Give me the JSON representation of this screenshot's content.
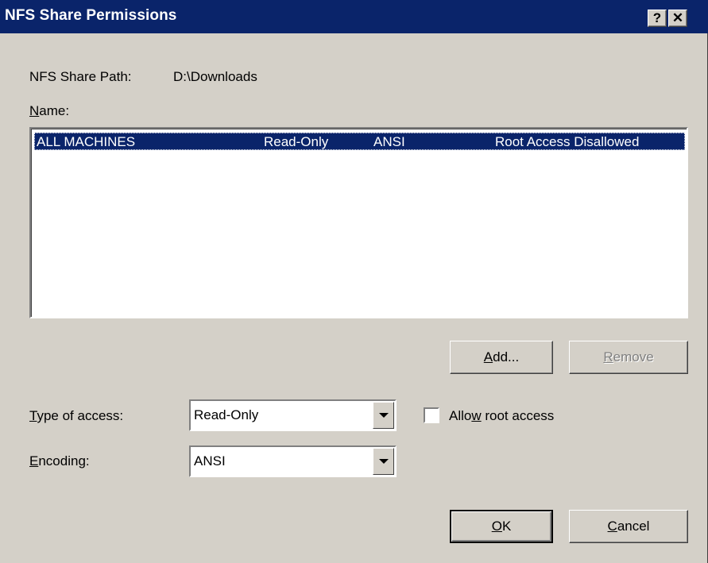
{
  "window": {
    "title": "NFS Share Permissions",
    "help_button": "?",
    "close_button": "✕"
  },
  "share": {
    "path_label": "NFS Share Path:",
    "path_value": "D:\\Downloads"
  },
  "name_label": {
    "mnemonic": "N",
    "rest": "ame:"
  },
  "permissions_list": {
    "rows": [
      {
        "name": "ALL MACHINES",
        "access": "Read-Only",
        "encoding": "ANSI",
        "root_access": "Root Access Disallowed",
        "selected": true
      }
    ]
  },
  "buttons": {
    "add": {
      "mnemonic": "A",
      "rest": "dd..."
    },
    "remove": {
      "mnemonic": "R",
      "rest": "emove",
      "disabled": true
    },
    "ok": {
      "mnemonic": "O",
      "rest": "K"
    },
    "cancel": {
      "mnemonic": "C",
      "rest": "ancel"
    }
  },
  "type_of_access": {
    "label_mnemonic": "T",
    "label_rest": "ype of access:",
    "value": "Read-Only"
  },
  "encoding": {
    "label_mnemonic": "E",
    "label_rest": "ncoding:",
    "value": "ANSI"
  },
  "allow_root": {
    "label_before": "Allo",
    "label_mnemonic": "w",
    "label_after": " root access",
    "checked": false
  },
  "colors": {
    "titlebar": "#0a246a",
    "face": "#d4d0c8",
    "selection": "#0a246a"
  }
}
